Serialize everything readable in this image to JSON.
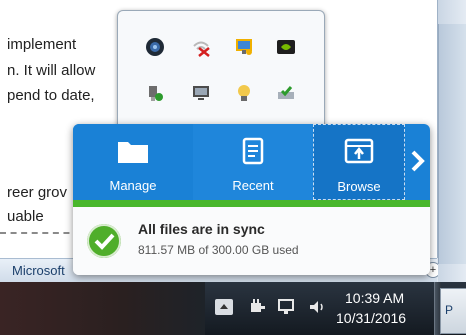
{
  "document": {
    "lines": [
      "implement",
      "n.  It will allow",
      "pend to date,",
      "reer grov",
      "uable"
    ],
    "status_text": "Microsoft",
    "status_btn": "+"
  },
  "tray_overflow": {
    "icons": [
      "webcam-icon",
      "wifi-disconnected-icon",
      "network-monitor-icon",
      "nvidia-icon",
      "usb-device-icon",
      "display-icon",
      "bulb-icon",
      "drive-check-icon"
    ]
  },
  "sync_panel": {
    "buttons": [
      {
        "label": "Manage",
        "icon": "folder-icon"
      },
      {
        "label": "Recent",
        "icon": "document-icon"
      },
      {
        "label": "Browse",
        "icon": "browse-window-icon"
      }
    ],
    "next_icon": "chevron-right-icon",
    "status_title": "All files are in sync",
    "status_detail": "811.57 MB of 300.00 GB used",
    "colors": {
      "toolbar": "#1a81d6",
      "progress": "#49b72c"
    }
  },
  "taskbar": {
    "tray_icons": [
      "show-hidden-icons",
      "power-plug-icon",
      "network-icon",
      "speaker-icon"
    ],
    "time": "10:39 AM",
    "date": "10/31/2016",
    "peek_label": "P"
  }
}
